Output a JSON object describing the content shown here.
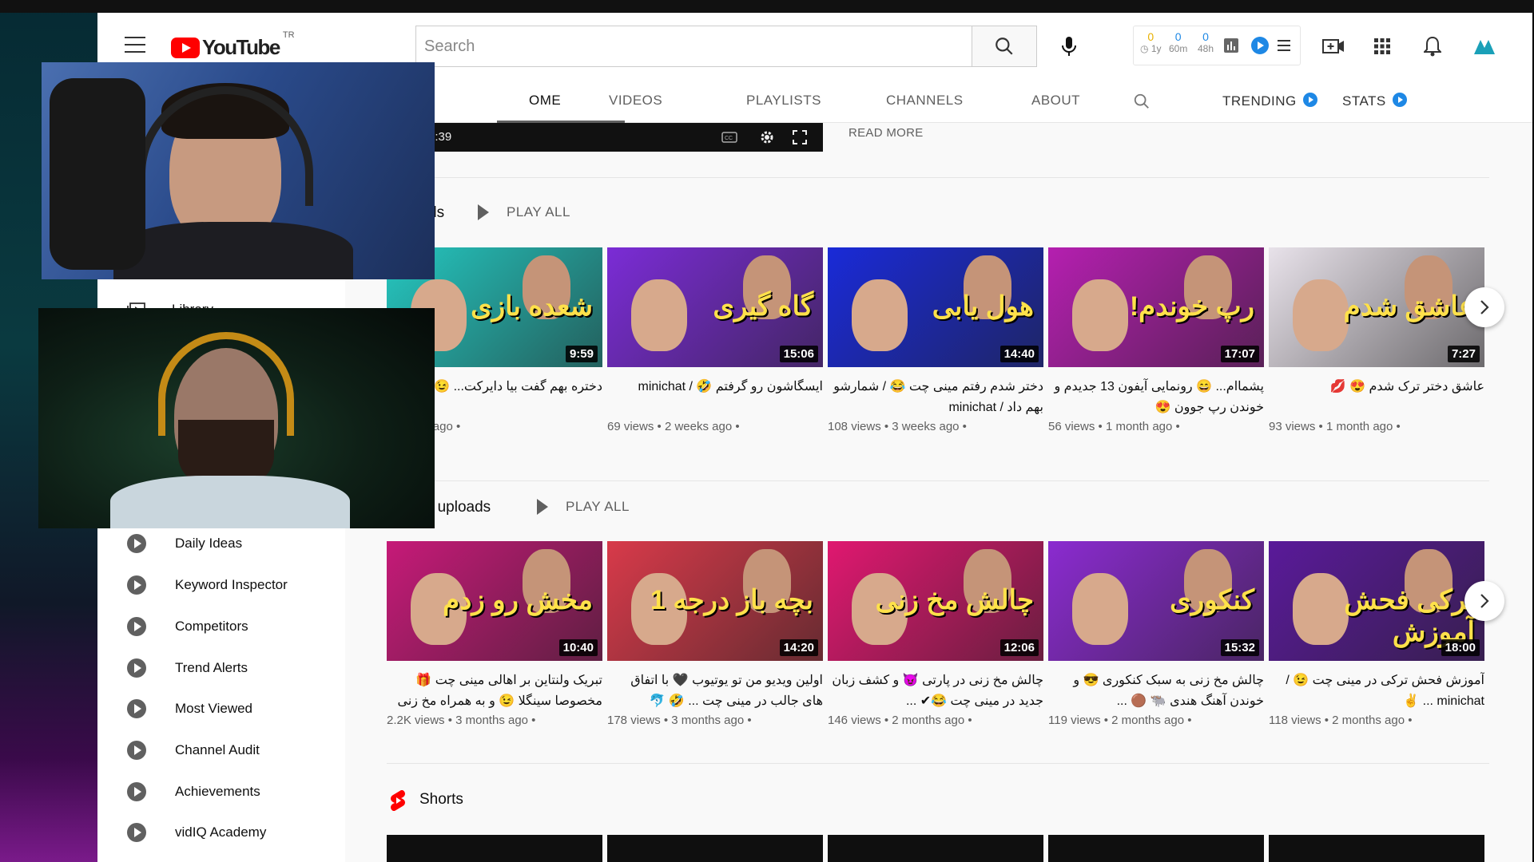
{
  "masthead": {
    "country_code": "TR",
    "logo_text": "YouTube",
    "search_placeholder": "Search",
    "vidiq_stats": [
      {
        "value": "0",
        "label": "1y"
      },
      {
        "value": "0",
        "label": "60m"
      },
      {
        "value": "0",
        "label": "48h"
      }
    ]
  },
  "tabs": [
    {
      "label": "OME"
    },
    {
      "label": "VIDEOS"
    },
    {
      "label": "PLAYLISTS"
    },
    {
      "label": "CHANNELS"
    },
    {
      "label": "ABOUT"
    },
    {
      "label": "TRENDING"
    },
    {
      "label": "STATS"
    }
  ],
  "sidebar": {
    "library_label": "Library",
    "vidiq_items": [
      {
        "label": "Daily Ideas"
      },
      {
        "label": "Keyword Inspector"
      },
      {
        "label": "Competitors"
      },
      {
        "label": "Trend Alerts"
      },
      {
        "label": "Most Viewed"
      },
      {
        "label": "Channel Audit"
      },
      {
        "label": "Achievements"
      },
      {
        "label": "vidIQ Academy"
      }
    ]
  },
  "player": {
    "time": "0:00 / 10:39"
  },
  "read_more": "READ MORE",
  "shelves": {
    "shelf1": {
      "title_fragment": "ds",
      "play_all": "PLAY ALL"
    },
    "shelf2": {
      "title_fragment": "r uploads",
      "play_all": "PLAY ALL"
    },
    "shorts": {
      "title": "Shorts"
    }
  },
  "row1": [
    {
      "duration": "9:59",
      "title": "دختره بهم گفت بیا دایرکت... 😉 بازی در",
      "meta": "• 7 days ago •",
      "thumb_text": "شعده بازی",
      "bg": "#25c7c0"
    },
    {
      "duration": "15:06",
      "title": "ایسگاشون رو گرفتم 🤣 / minichat",
      "meta": "69 views • 2 weeks ago •",
      "thumb_text": "گاه گیری",
      "bg": "#7b2cd6"
    },
    {
      "duration": "14:40",
      "title": "دختر شدم رفتم مینی چت 😂 / شمارشو بهم داد / minichat",
      "meta": "108 views • 3 weeks ago •",
      "thumb_text": "هول یابی",
      "bg": "#1a2ad8"
    },
    {
      "duration": "17:07",
      "title": "پشماام... 😄 رونمایی آیفون 13 جدیدم و خوندن رپ جوون 😍",
      "meta": "56 views • 1 month ago •",
      "thumb_text": "رپ خوندم!",
      "bg": "#b51fb0"
    },
    {
      "duration": "7:27",
      "title": "عاشق دختر ترک شدم 😍 💋",
      "meta": "93 views • 1 month ago •",
      "thumb_text": "عاشق شدم",
      "bg": "#e8e2ea"
    }
  ],
  "row2": [
    {
      "duration": "10:40",
      "title": "تبریک ولنتاین بر اهالی مینی چت 🎁 مخصوصا سینگلا 😉 و به همراه مخ زنی ...",
      "meta": "2.2K views • 3 months ago •",
      "thumb_text": "مخش رو زدم",
      "bg": "#c61a78"
    },
    {
      "duration": "14:20",
      "title": "اولین ویدیو من تو یوتیوب 🖤 با اتفاق های جالب در مینی چت ... 🤣 🐬",
      "meta": "178 views • 3 months ago •",
      "thumb_text": "بچه باز درجه 1",
      "bg": "#d83a4a"
    },
    {
      "duration": "12:06",
      "title": "چالش مخ زنی در پارتی 😈 و کشف زبان جدید در مینی چت 😂✔ ...",
      "meta": "146 views • 2 months ago •",
      "thumb_text": "چالش مخ زنی",
      "bg": "#e01870"
    },
    {
      "duration": "15:32",
      "title": "چالش مخ زنی به سبک کنکوری 😎 و خوندن آهنگ هندی 🐃 🟤 ...",
      "meta": "119 views • 2 months ago •",
      "thumb_text": "کنکوری",
      "bg": "#8b2bd0"
    },
    {
      "duration": "18:00",
      "title": "آموزش فحش ترکی در مینی چت 😉 / minichat ... ✌",
      "meta": "118 views • 2 months ago •",
      "thumb_text": "ترکی فحش آموزش",
      "bg": "#5a1a9a"
    }
  ],
  "colors": {
    "youtube_red": "#ff0000",
    "vidiq_blue": "#1e88e5",
    "text_secondary": "#606060"
  }
}
